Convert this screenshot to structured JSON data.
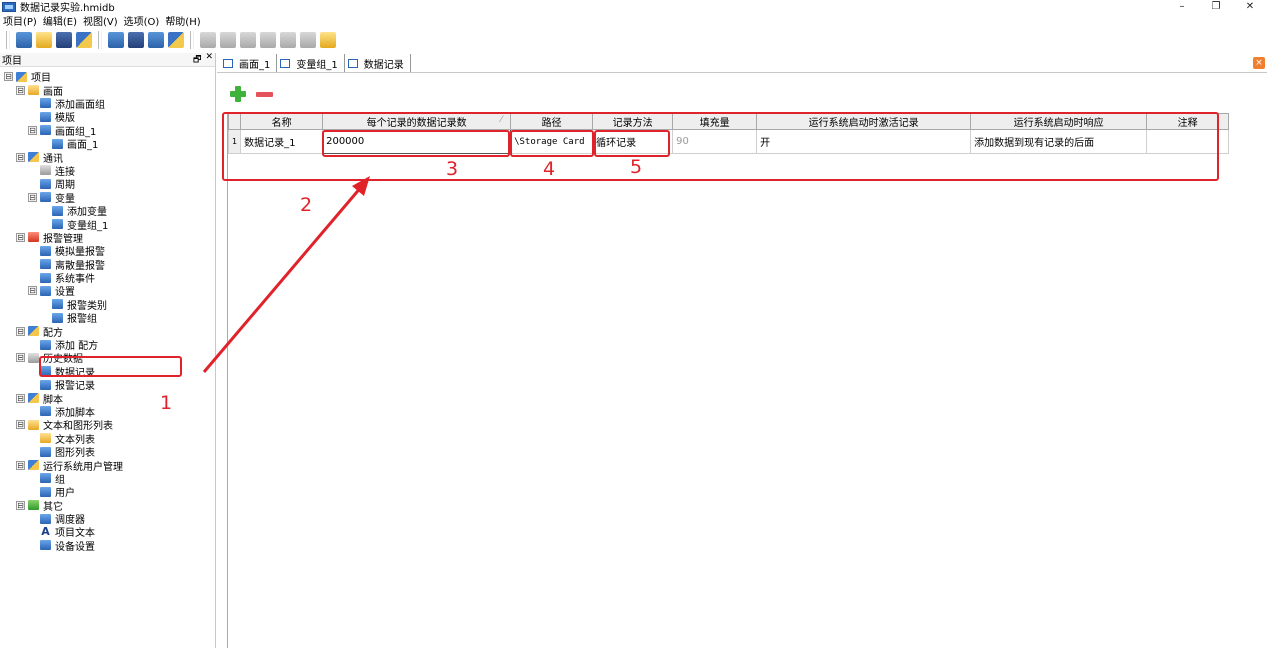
{
  "window": {
    "title": "数据记录实验.hmidb",
    "controls": [
      "–",
      "❐",
      "✕"
    ]
  },
  "menubar": [
    "项目(P)",
    "编辑(E)",
    "视图(V)",
    "选项(O)",
    "帮助(H)"
  ],
  "left_panel": {
    "title": "项目",
    "header_buttons": [
      "🗗",
      "✕"
    ],
    "tree": [
      {
        "id": "root",
        "label": "项目",
        "level": 0,
        "exp": "⊟",
        "icon": "ic-mix",
        "icon_name": "project-icon"
      },
      {
        "id": "screens",
        "label": "画面",
        "level": 1,
        "exp": "⊟",
        "icon": "ic-yellow",
        "icon_name": "screen-folder-icon"
      },
      {
        "id": "add-screen-group",
        "label": "添加画面组",
        "level": 2,
        "exp": "",
        "icon": "ic-blue",
        "icon_name": "add-group-icon"
      },
      {
        "id": "template",
        "label": "模版",
        "level": 2,
        "exp": "",
        "icon": "ic-blue",
        "icon_name": "template-icon"
      },
      {
        "id": "screen-group-1",
        "label": "画面组_1",
        "level": 2,
        "exp": "⊟",
        "icon": "ic-blue",
        "icon_name": "screen-group-icon"
      },
      {
        "id": "screen-1",
        "label": "画面_1",
        "level": 3,
        "exp": "",
        "icon": "ic-blue",
        "icon_name": "screen-icon"
      },
      {
        "id": "comm",
        "label": "通讯",
        "level": 1,
        "exp": "⊟",
        "icon": "ic-mix",
        "icon_name": "communication-icon"
      },
      {
        "id": "connection",
        "label": "连接",
        "level": 2,
        "exp": "",
        "icon": "ic-gray",
        "icon_name": "connection-icon"
      },
      {
        "id": "period",
        "label": "周期",
        "level": 2,
        "exp": "",
        "icon": "ic-blue",
        "icon_name": "cycle-icon"
      },
      {
        "id": "variables",
        "label": "变量",
        "level": 2,
        "exp": "⊟",
        "icon": "ic-blue",
        "icon_name": "variable-icon"
      },
      {
        "id": "add-variable",
        "label": "添加变量",
        "level": 3,
        "exp": "",
        "icon": "ic-blue",
        "icon_name": "add-variable-icon"
      },
      {
        "id": "variable-group-1",
        "label": "变量组_1",
        "level": 3,
        "exp": "",
        "icon": "ic-blue",
        "icon_name": "variable-group-icon"
      },
      {
        "id": "alarm-mgmt",
        "label": "报警管理",
        "level": 1,
        "exp": "⊟",
        "icon": "ic-red",
        "icon_name": "alarm-folder-icon"
      },
      {
        "id": "analog-alarm",
        "label": "模拟量报警",
        "level": 2,
        "exp": "",
        "icon": "ic-blue",
        "icon_name": "analog-alarm-icon"
      },
      {
        "id": "discrete-alarm",
        "label": "离散量报警",
        "level": 2,
        "exp": "",
        "icon": "ic-blue",
        "icon_name": "discrete-alarm-icon"
      },
      {
        "id": "system-event",
        "label": "系统事件",
        "level": 2,
        "exp": "",
        "icon": "ic-blue",
        "icon_name": "system-event-icon"
      },
      {
        "id": "settings",
        "label": "设置",
        "level": 2,
        "exp": "⊟",
        "icon": "ic-blue",
        "icon_name": "settings-icon"
      },
      {
        "id": "alarm-class",
        "label": "报警类别",
        "level": 3,
        "exp": "",
        "icon": "ic-blue",
        "icon_name": "alarm-class-icon"
      },
      {
        "id": "alarm-group",
        "label": "报警组",
        "level": 3,
        "exp": "",
        "icon": "ic-blue",
        "icon_name": "alarm-group-icon"
      },
      {
        "id": "recipe",
        "label": "配方",
        "level": 1,
        "exp": "⊟",
        "icon": "ic-mix",
        "icon_name": "recipe-icon"
      },
      {
        "id": "add-recipe",
        "label": "添加 配方",
        "level": 2,
        "exp": "",
        "icon": "ic-blue",
        "icon_name": "add-recipe-icon"
      },
      {
        "id": "history",
        "label": "历史数据",
        "level": 1,
        "exp": "⊟",
        "icon": "ic-gray",
        "icon_name": "history-icon"
      },
      {
        "id": "data-log",
        "label": "数据记录",
        "level": 2,
        "exp": "",
        "icon": "ic-blue",
        "icon_name": "data-log-icon"
      },
      {
        "id": "alarm-log",
        "label": "报警记录",
        "level": 2,
        "exp": "",
        "icon": "ic-blue",
        "icon_name": "alarm-log-icon"
      },
      {
        "id": "scripts",
        "label": "脚本",
        "level": 1,
        "exp": "⊟",
        "icon": "ic-mix",
        "icon_name": "script-icon"
      },
      {
        "id": "add-script",
        "label": "添加脚本",
        "level": 2,
        "exp": "",
        "icon": "ic-blue",
        "icon_name": "add-script-icon"
      },
      {
        "id": "text-graphic-lists",
        "label": "文本和图形列表",
        "level": 1,
        "exp": "⊟",
        "icon": "ic-yellow",
        "icon_name": "list-folder-icon"
      },
      {
        "id": "text-list",
        "label": "文本列表",
        "level": 2,
        "exp": "",
        "icon": "ic-yellow",
        "icon_name": "text-list-icon"
      },
      {
        "id": "graphic-list",
        "label": "图形列表",
        "level": 2,
        "exp": "",
        "icon": "ic-blue",
        "icon_name": "graphic-list-icon"
      },
      {
        "id": "runtime-users",
        "label": "运行系统用户管理",
        "level": 1,
        "exp": "⊟",
        "icon": "ic-mix",
        "icon_name": "user-management-icon"
      },
      {
        "id": "groups",
        "label": "组",
        "level": 2,
        "exp": "",
        "icon": "ic-blue",
        "icon_name": "group-icon"
      },
      {
        "id": "users",
        "label": "用户",
        "level": 2,
        "exp": "",
        "icon": "ic-blue",
        "icon_name": "user-icon"
      },
      {
        "id": "others",
        "label": "其它",
        "level": 1,
        "exp": "⊟",
        "icon": "ic-green",
        "icon_name": "others-icon"
      },
      {
        "id": "scheduler",
        "label": "调度器",
        "level": 2,
        "exp": "",
        "icon": "ic-blue",
        "icon_name": "scheduler-icon"
      },
      {
        "id": "project-text",
        "label": "项目文本",
        "level": 2,
        "exp": "",
        "icon": "ic-text",
        "icon_glyph": "A",
        "icon_name": "project-text-icon"
      },
      {
        "id": "device-settings",
        "label": "设备设置",
        "level": 2,
        "exp": "",
        "icon": "ic-blue",
        "icon_name": "device-settings-icon"
      }
    ]
  },
  "tabs": [
    {
      "label": "画面_1",
      "icon_name": "screen-tab-icon"
    },
    {
      "label": "变量组_1",
      "icon_name": "variable-group-tab-icon"
    },
    {
      "label": "数据记录",
      "icon_name": "data-log-tab-icon"
    }
  ],
  "tab_close_label": "×",
  "grid": {
    "headers": [
      "名称",
      "每个记录的数据记录数",
      "路径",
      "记录方法",
      "填充量",
      "运行系统启动时激活记录",
      "运行系统启动时响应",
      "注释"
    ],
    "sort_mark": "⁄",
    "rows": [
      {
        "num": "1",
        "cells": [
          "数据记录_1",
          "200000",
          "\\Storage Card",
          "循环记录",
          "90",
          "开",
          "添加数据到现有记录的后面",
          ""
        ]
      }
    ]
  },
  "annotations": {
    "n1": "1",
    "n2": "2",
    "n3": "3",
    "n4": "4",
    "n5": "5",
    "color": "#e0232a"
  }
}
